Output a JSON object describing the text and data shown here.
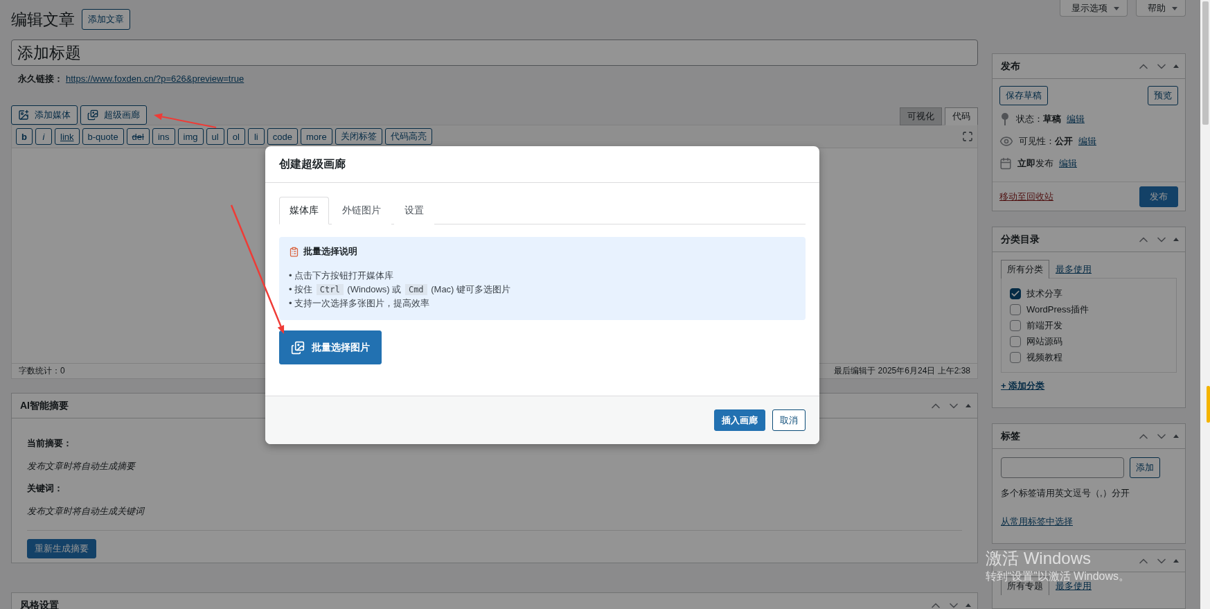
{
  "header": {
    "title": "编辑文章",
    "add_button": "添加文章"
  },
  "screen_meta": [
    {
      "label": "显示选项"
    },
    {
      "label": "帮助"
    }
  ],
  "editor": {
    "title_placeholder": "添加标题",
    "permalink_label": "永久链接：",
    "permalink_url": "https://www.foxden.cn/?p=626&preview=true",
    "media_buttons": [
      {
        "label": "添加媒体",
        "kind": "media"
      },
      {
        "label": "超级画廊",
        "kind": "gallery"
      }
    ],
    "mode_tabs": [
      {
        "label": "可视化",
        "selected": false
      },
      {
        "label": "代码",
        "selected": true
      }
    ],
    "quicktags": [
      {
        "label": "b",
        "kind": "bold"
      },
      {
        "label": "i",
        "kind": "italic"
      },
      {
        "label": "link",
        "kind": "underline"
      },
      {
        "label": "b-quote",
        "kind": "plain"
      },
      {
        "label": "del",
        "kind": "strike"
      },
      {
        "label": "ins",
        "kind": "plain"
      },
      {
        "label": "img",
        "kind": "plain"
      },
      {
        "label": "ul",
        "kind": "plain"
      },
      {
        "label": "ol",
        "kind": "plain"
      },
      {
        "label": "li",
        "kind": "plain"
      },
      {
        "label": "code",
        "kind": "plain"
      },
      {
        "label": "more",
        "kind": "plain"
      },
      {
        "label": "关闭标签",
        "kind": "plain"
      },
      {
        "label": "代码高亮",
        "kind": "plain"
      }
    ],
    "word_count": "字数统计：0",
    "last_edited": "最后编辑于 2025年6月24日 上午2:38"
  },
  "ai_summary": {
    "title": "AI智能摘要",
    "fields": [
      {
        "label": "当前摘要：",
        "value": "发布文章时将自动生成摘要"
      },
      {
        "label": "关键词：",
        "value": "发布文章时将自动生成关键词"
      }
    ],
    "button": "重新生成摘要"
  },
  "style_box": {
    "title": "风格设置"
  },
  "sidebar": {
    "publish": {
      "title": "发布",
      "save": "保存草稿",
      "preview": "预览",
      "rows": [
        {
          "kind": "pin",
          "text": "状态：**草稿**",
          "link": "编辑"
        },
        {
          "kind": "eye",
          "text": "可见性：**公开**",
          "link": "编辑"
        },
        {
          "kind": "calendar",
          "text": "**立即**发布",
          "link": "编辑"
        }
      ],
      "trash": "移动至回收站",
      "publish": "发布"
    },
    "categories": {
      "title": "分类目录",
      "tabs": [
        {
          "label": "所有分类",
          "selected": true
        },
        {
          "label": "最多使用",
          "selected": false
        }
      ],
      "items": [
        {
          "label": "技术分享",
          "checked": true
        },
        {
          "label": "WordPress插件",
          "checked": false
        },
        {
          "label": "前端开发",
          "checked": false
        },
        {
          "label": "网站源码",
          "checked": false
        },
        {
          "label": "视频教程",
          "checked": false
        }
      ],
      "add_link": "+ 添加分类"
    },
    "tags": {
      "title": "标签",
      "button": "添加",
      "hint": "多个标签请用英文逗号（,）分开",
      "link": "从常用标签中选择"
    },
    "topics": {
      "tabs": [
        {
          "label": "所有专题",
          "selected": true
        },
        {
          "label": "最多使用",
          "selected": false
        }
      ]
    }
  },
  "modal": {
    "title": "创建超级画廊",
    "tabs": [
      {
        "label": "媒体库",
        "selected": true
      },
      {
        "label": "外链图片",
        "selected": false
      },
      {
        "label": "设置",
        "selected": false
      }
    ],
    "notice": {
      "title": "批量选择说明",
      "lines": [
        [
          {
            "kind": "text",
            "text": "• 点击下方按钮打开媒体库"
          }
        ],
        [
          {
            "kind": "text",
            "text": "• 按住 "
          },
          {
            "kind": "code",
            "text": "Ctrl"
          },
          {
            "kind": "text",
            "text": " (Windows) 或 "
          },
          {
            "kind": "code",
            "text": "Cmd"
          },
          {
            "kind": "text",
            "text": " (Mac) 键可多选图片"
          }
        ],
        [
          {
            "kind": "text",
            "text": "• 支持一次选择多张图片，提高效率"
          }
        ]
      ]
    },
    "select_button": "批量选择图片",
    "footer_buttons": [
      {
        "label": "插入画廊",
        "kind": "primary"
      },
      {
        "label": "取消",
        "kind": "secondary"
      }
    ]
  },
  "watermark": {
    "title": "激活 Windows",
    "subtitle": "转到“设置”以激活 Windows。"
  }
}
